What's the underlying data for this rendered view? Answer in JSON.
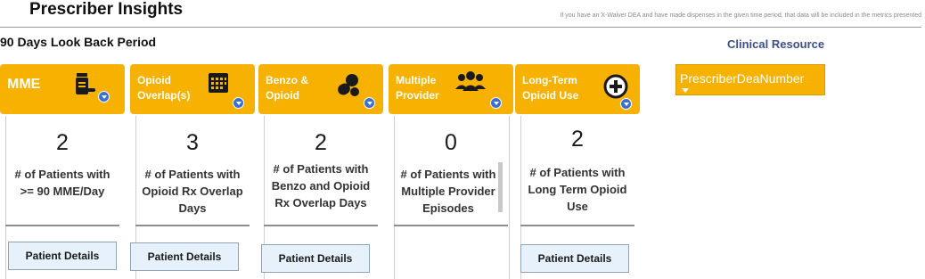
{
  "header": {
    "title": "Prescriber Insights",
    "disclaimer": "If you have an X-Waiver DEA and have made dispenses in the given time period, that data will be included in the metrics presented"
  },
  "period": {
    "label": "90 Days Look Back Period"
  },
  "clinical_resource": {
    "label": "Clinical Resource"
  },
  "dea_dropdown": {
    "label": "PrescriberDeaNumber"
  },
  "cards": [
    {
      "header": "MME",
      "icon": "pill-bottle-icon",
      "count": "2",
      "description": "# of Patients with >= 90 MME/Day",
      "button": "Patient Details"
    },
    {
      "header": "Opioid Overlap(s)",
      "icon": "calendar-icon",
      "count": "3",
      "description": "# of Patients with Opioid Rx Overlap Days",
      "button": "Patient Details"
    },
    {
      "header": "Benzo & Opioid",
      "icon": "pills-icon",
      "count": "2",
      "description": "# of Patients with Benzo and Opioid Rx Overlap Days",
      "button": "Patient Details"
    },
    {
      "header": "Multiple Provider",
      "icon": "people-icon",
      "count": "0",
      "description": "# of Patients with Multiple Provider Episodes"
    },
    {
      "header": "Long-Term Opioid Use",
      "icon": "plus-circle-icon",
      "count": "2",
      "description": "# of Patients with Long Term Opioid Use",
      "button": "Patient Details"
    }
  ],
  "colors": {
    "card_header": "#f7b100",
    "button_bg": "#e6f1fb",
    "link": "#3c4f8c",
    "info_badge": "#3b6fd0"
  }
}
